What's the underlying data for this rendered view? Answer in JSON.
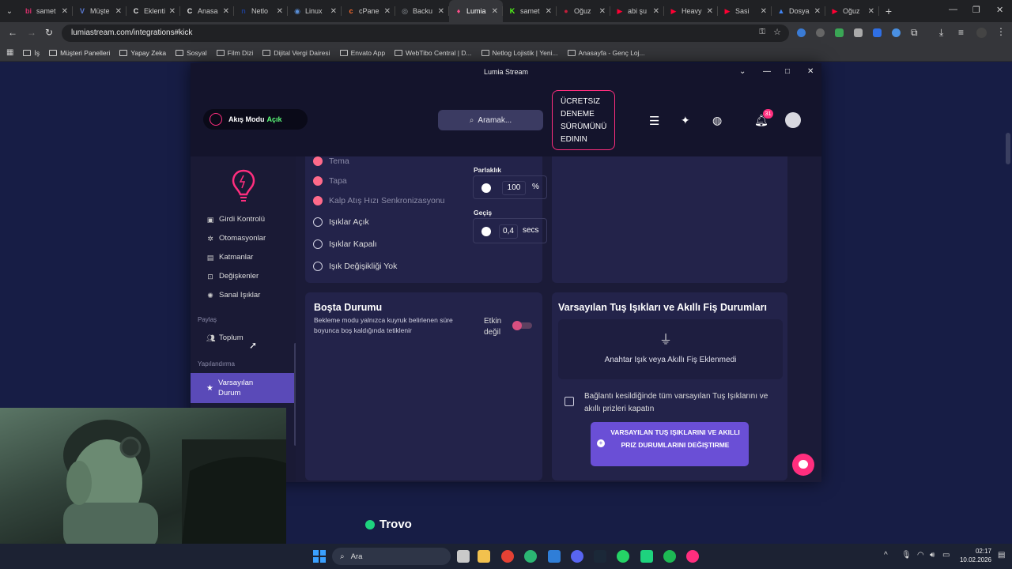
{
  "browser": {
    "tabs": [
      {
        "label": "samet",
        "color": "#d62f6b",
        "glyph": "bi"
      },
      {
        "label": "Müşte",
        "color": "#5b7bd5",
        "glyph": "V"
      },
      {
        "label": "Eklenti",
        "color": "#e8e8e8",
        "glyph": "C"
      },
      {
        "label": "Anasa",
        "color": "#e8e8e8",
        "glyph": "C"
      },
      {
        "label": "Netlo",
        "color": "#1e3d8f",
        "glyph": "n"
      },
      {
        "label": "Linux",
        "color": "#5a8fd8",
        "glyph": "◉"
      },
      {
        "label": "cPane",
        "color": "#ff6c2c",
        "glyph": "c"
      },
      {
        "label": "Backu",
        "color": "#9aa0a6",
        "glyph": "◎"
      },
      {
        "label": "Lumia",
        "color": "#ff4f8b",
        "glyph": "♦"
      },
      {
        "label": "samet",
        "color": "#53fc18",
        "glyph": "K"
      },
      {
        "label": "Oğuz",
        "color": "#c41e3a",
        "glyph": "●"
      },
      {
        "label": "abi şu",
        "color": "#ff0033",
        "glyph": "▶"
      },
      {
        "label": "Heavy",
        "color": "#ff0033",
        "glyph": "▶"
      },
      {
        "label": "Sasi",
        "color": "#ff0033",
        "glyph": "▶"
      },
      {
        "label": "Dosya",
        "color": "#4285f4",
        "glyph": "▲"
      },
      {
        "label": "Oğuz",
        "color": "#ff0033",
        "glyph": "▶"
      }
    ],
    "active_tab_index": 8,
    "url": "lumiastream.com/integrations#kick",
    "bookmarks": [
      "İş",
      "Müşteri Panelleri",
      "Yapay Zeka",
      "Sosyal",
      "Film Dizi",
      "Dijital Vergi Dairesi",
      "Envato App",
      "WebTibo Central | D...",
      "Netlog Lojistik | Yeni...",
      "Anasayfa - Genç Loj..."
    ],
    "page_bottom_label": "Trovo"
  },
  "lumia": {
    "window_title": "Lumia Stream",
    "stream_mode_label": "Akış Modu",
    "stream_mode_value": "Açık",
    "search_placeholder": "Aramak...",
    "trial_button": "ÜCRETSIZ DENEME SÜRÜMÜNÜ EDININ",
    "notification_count": "31",
    "sidebar": {
      "items": [
        {
          "label": "Girdi Kontrolü",
          "icon": "input-icon"
        },
        {
          "label": "Otomasyonlar",
          "icon": "automation-icon"
        },
        {
          "label": "Katmanlar",
          "icon": "layers-icon"
        },
        {
          "label": "Değişkenler",
          "icon": "variables-icon"
        },
        {
          "label": "Sanal Işıklar",
          "icon": "virtual-lights-icon"
        }
      ],
      "share_label": "Paylaş",
      "community_label": "Toplum",
      "config_label": "Yapılandırma",
      "default_state_label": "Varsayılan Durum"
    },
    "mode_options": [
      {
        "label": "Tema",
        "type": "pink",
        "dim": true
      },
      {
        "label": "Tapa",
        "type": "pink",
        "dim": true
      },
      {
        "label": "Kalp Atış Hızı Senkronizasyonu",
        "type": "pink",
        "dim": true
      },
      {
        "label": "Işıklar Açık",
        "type": "radio",
        "dim": false
      },
      {
        "label": "Işıklar Kapalı",
        "type": "radio",
        "dim": false
      },
      {
        "label": "Işık Değişikliği Yok",
        "type": "radio",
        "dim": false
      }
    ],
    "brightness": {
      "label": "Parlaklık",
      "value": "100",
      "unit": "%"
    },
    "transition": {
      "label": "Geçiş",
      "value": "0,4",
      "unit": "secs"
    },
    "idle": {
      "title": "Boşta Durumu",
      "description": "Bekleme modu yalnızca kuyruk belirlenen süre boyunca boş kaldığında tetiklenir",
      "toggle_label": "Etkin değil"
    },
    "default_keys": {
      "title": "Varsayılan Tuş Işıkları ve Akıllı Fiş Durumları",
      "empty_text": "Anahtar Işık veya Akıllı Fiş Eklenmedi",
      "checkbox_label": "Bağlantı kesildiğinde tüm varsayılan Tuş Işıklarını ve akıllı prizleri kapatın",
      "button_label": "VARSAYILAN TUŞ IŞIKLARINI VE AKILLI PRIZ DURUMLARINI DEĞIŞTIRME"
    }
  },
  "taskbar": {
    "search_label": "Ara",
    "time": "02:17",
    "date": "10.02.2026"
  },
  "colors": {
    "accent": "#ff2e7e",
    "button_purple": "#6a4fd6",
    "window_bg": "#1d1d3b"
  }
}
